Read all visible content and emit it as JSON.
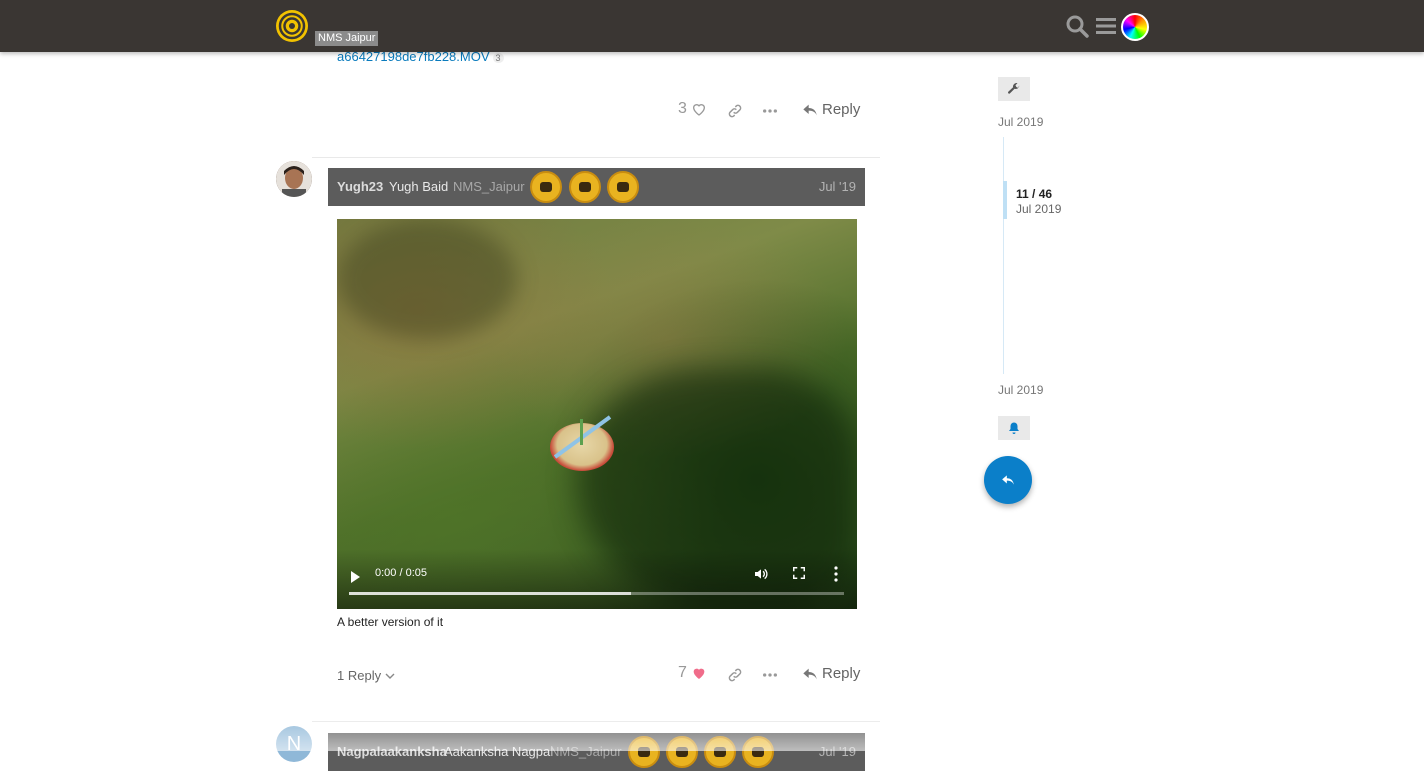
{
  "header": {
    "site_name": "NMS Jaipur",
    "logo_icon": "spiral-logo-icon",
    "search_icon": "search-icon",
    "menu_icon": "hamburger-menu-icon",
    "accent_color": "#3a3633"
  },
  "previous_post": {
    "attachment_link": "a66427198de7fb228.MOV",
    "link_click_count": "3",
    "like_count": "3",
    "reply_label": "Reply"
  },
  "post": {
    "username": "Yugh23",
    "full_name": "Yugh Baid",
    "group": "NMS_Jaipur",
    "date": "Jul '19",
    "video": {
      "time": "0:00 / 0:05",
      "progress": 0.57
    },
    "caption": "A better version of it",
    "replies_label": "1 Reply",
    "like_count": "7",
    "reply_label": "Reply"
  },
  "next_post": {
    "avatar_letter": "N",
    "username": "Nagpalaakanksha",
    "full_name": "Aakanksha Nagpal",
    "group": "NMS_Jaipur",
    "date": "Jul '19"
  },
  "timeline": {
    "top_date": "Jul 2019",
    "position": "11 / 46",
    "position_date": "Jul 2019",
    "bottom_date": "Jul 2019"
  }
}
